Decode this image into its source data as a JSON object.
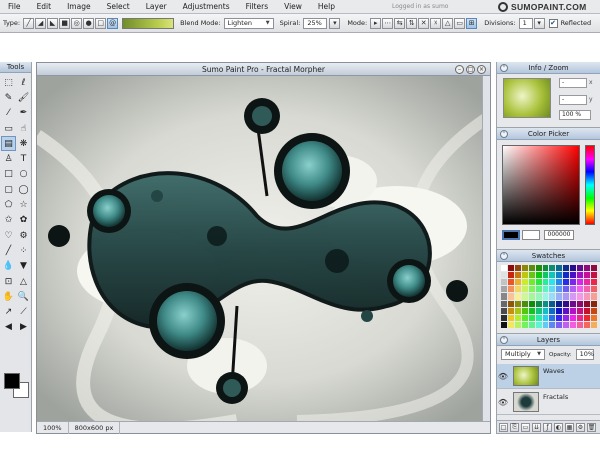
{
  "menu": {
    "items": [
      "File",
      "Edit",
      "Image",
      "Select",
      "Layer",
      "Adjustments",
      "Filters",
      "View",
      "Help"
    ],
    "logged_in": "Logged in as sumo",
    "logo": "SUMOPAINT.COM"
  },
  "options": {
    "type_label": "Type:",
    "blend_label": "Blend Mode:",
    "blend_value": "Lighten",
    "spiral_label": "Spiral:",
    "spiral_value": "25%",
    "mode_label": "Mode:",
    "divisions_label": "Divisions:",
    "divisions_value": "1",
    "reflected_label": "Reflected",
    "reflected_checked": "✔"
  },
  "tools": {
    "title": "Tools",
    "icons": [
      {
        "name": "marquee-rect-icon",
        "glyph": "⬚"
      },
      {
        "name": "lasso-icon",
        "glyph": "ℓ"
      },
      {
        "name": "pencil-icon",
        "glyph": "✎"
      },
      {
        "name": "brush-icon",
        "glyph": "🖌"
      },
      {
        "name": "eyedropper-icon",
        "glyph": "⁄"
      },
      {
        "name": "pen-icon",
        "glyph": "✒"
      },
      {
        "name": "eraser-icon",
        "glyph": "▭"
      },
      {
        "name": "smudge-icon",
        "glyph": "☝"
      },
      {
        "name": "gradient-icon",
        "glyph": "▤"
      },
      {
        "name": "fractal-morpher-icon",
        "glyph": "❋"
      },
      {
        "name": "stamp-icon",
        "glyph": "♙"
      },
      {
        "name": "text-icon",
        "glyph": "T"
      },
      {
        "name": "rectangle-icon",
        "glyph": "□"
      },
      {
        "name": "ellipse-icon",
        "glyph": "○"
      },
      {
        "name": "rounded-rect-icon",
        "glyph": "▢"
      },
      {
        "name": "circle-icon",
        "glyph": "◯"
      },
      {
        "name": "polygon-icon",
        "glyph": "⬠"
      },
      {
        "name": "star-icon",
        "glyph": "☆"
      },
      {
        "name": "shape-star-icon",
        "glyph": "✩"
      },
      {
        "name": "flower-icon",
        "glyph": "✿"
      },
      {
        "name": "heart-icon",
        "glyph": "♡"
      },
      {
        "name": "gear-icon",
        "glyph": "⚙"
      },
      {
        "name": "line-icon",
        "glyph": "╱"
      },
      {
        "name": "spray-icon",
        "glyph": "⁘"
      },
      {
        "name": "drop-icon",
        "glyph": "💧"
      },
      {
        "name": "bucket-icon",
        "glyph": "▼"
      },
      {
        "name": "clone-icon",
        "glyph": "⊡"
      },
      {
        "name": "sharpen-icon",
        "glyph": "△"
      },
      {
        "name": "hand-icon",
        "glyph": "✋"
      },
      {
        "name": "zoom-icon",
        "glyph": "🔍"
      },
      {
        "name": "picker-icon",
        "glyph": "↗"
      },
      {
        "name": "measure-icon",
        "glyph": "⟋"
      },
      {
        "name": "arrow-left-icon",
        "glyph": "◀"
      },
      {
        "name": "arrow-right-icon",
        "glyph": "▶"
      }
    ]
  },
  "document": {
    "title": "Sumo Paint Pro - Fractal Morpher",
    "zoom": "100%",
    "size": "800x600 px"
  },
  "info_zoom": {
    "title": "Info / Zoom",
    "x_value": "-",
    "y_value": "-",
    "x_label": "x",
    "y_label": "y",
    "zoom_value": "100 %"
  },
  "color_picker": {
    "title": "Color Picker",
    "hex": "000000"
  },
  "swatches": {
    "title": "Swatches"
  },
  "layers": {
    "title": "Layers",
    "blend": "Multiply",
    "opacity_label": "Opacity:",
    "opacity_value": "10%",
    "items": [
      {
        "name": "Waves"
      },
      {
        "name": "Fractals"
      }
    ]
  }
}
